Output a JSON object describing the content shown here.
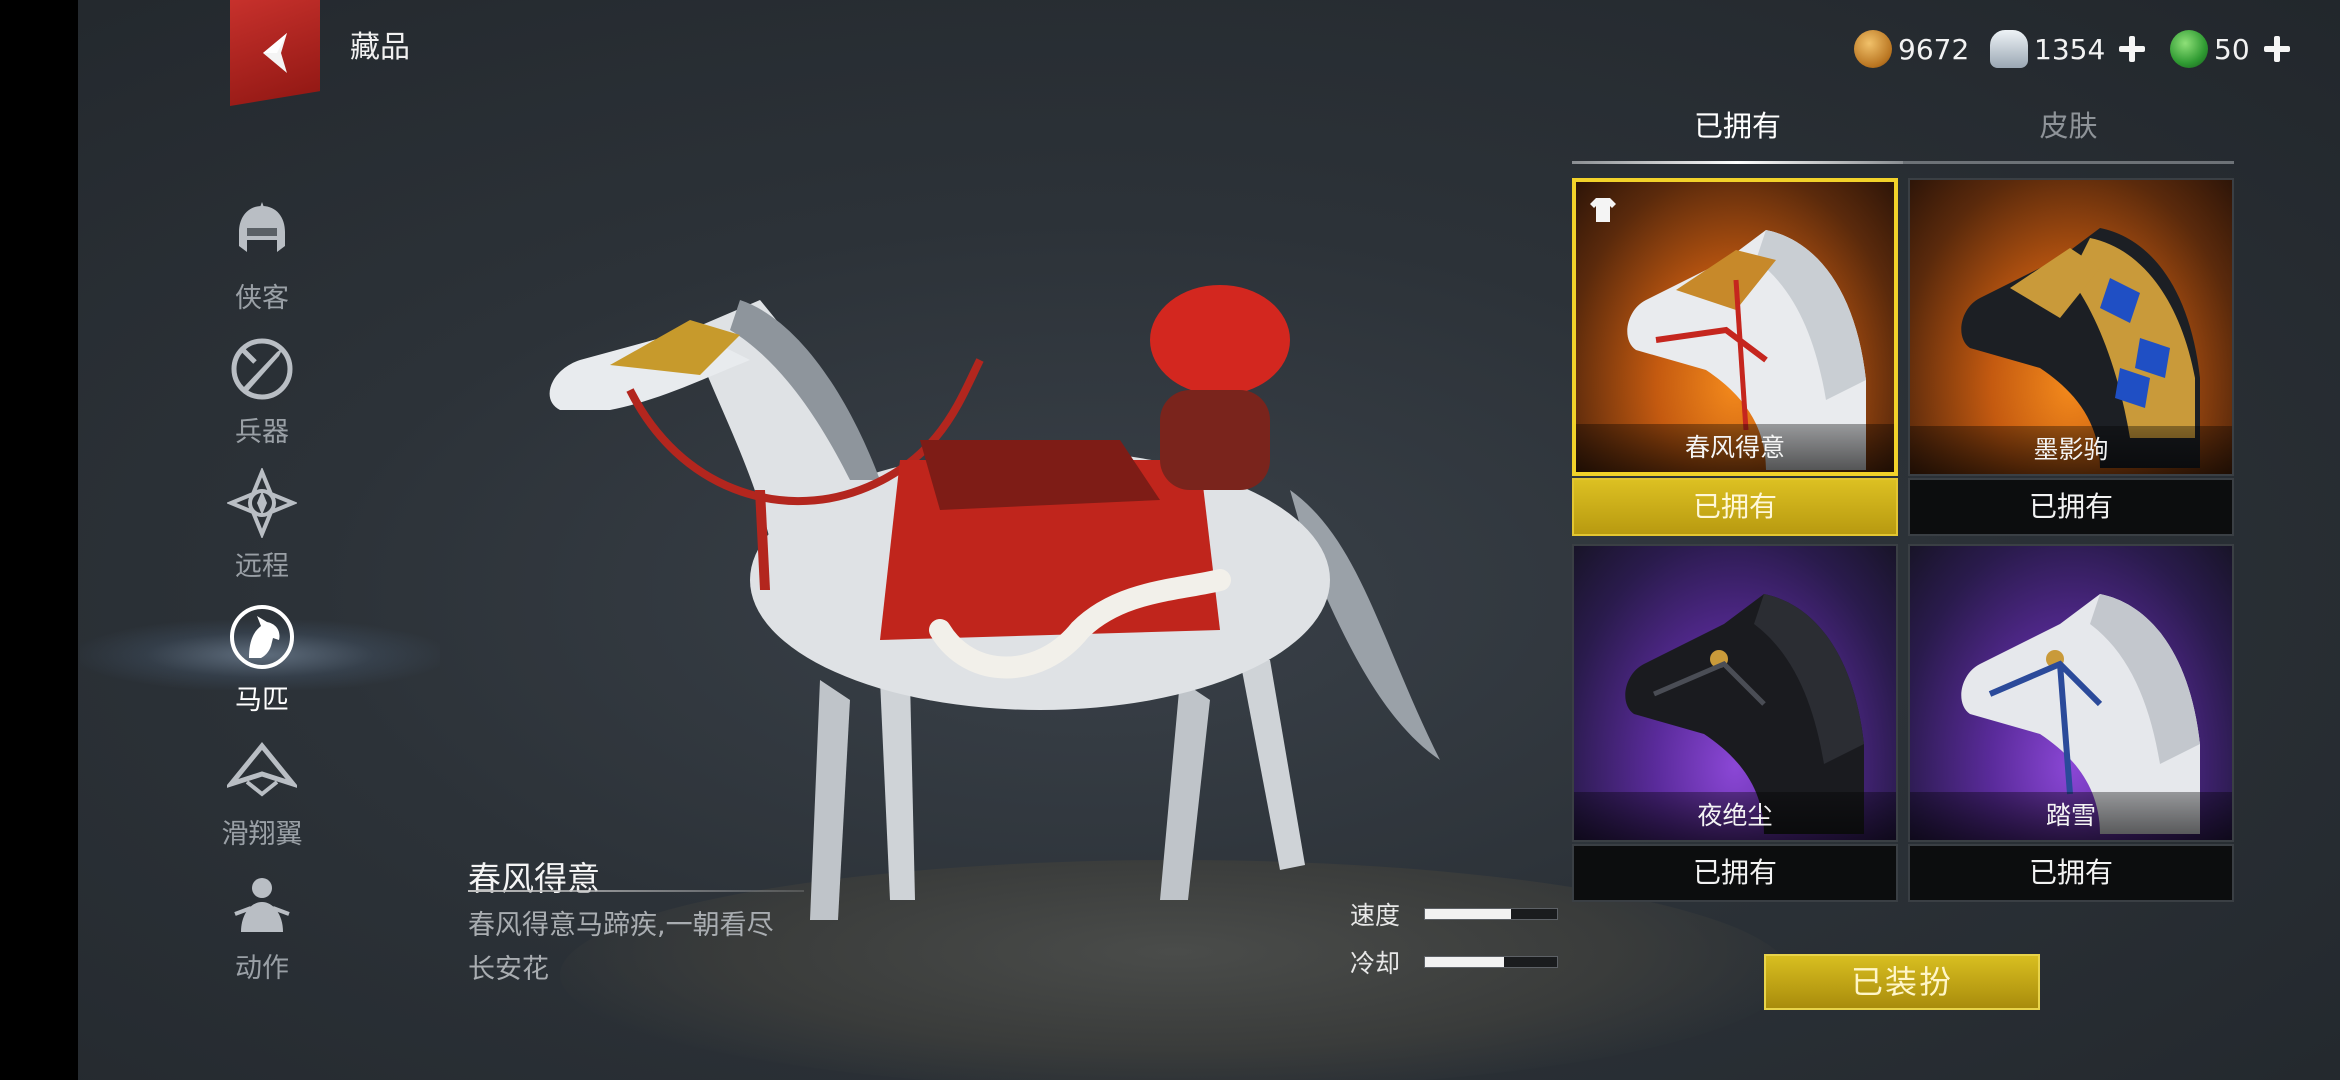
{
  "header": {
    "title": "藏品",
    "back_icon": "back-arrow-icon"
  },
  "currencies": [
    {
      "name": "copper-coin",
      "value": "9672",
      "icon": "coin-icon",
      "color": "#c98a2e",
      "has_add": false
    },
    {
      "name": "silver-ingot",
      "value": "1354",
      "icon": "silver-ingot-icon",
      "color": "#c9d3dc",
      "has_add": true
    },
    {
      "name": "jade",
      "value": "50",
      "icon": "jade-icon",
      "color": "#3aa23c",
      "has_add": true
    }
  ],
  "sidebar": {
    "items": [
      {
        "label": "侠客",
        "icon": "helmet-icon",
        "active": false
      },
      {
        "label": "兵器",
        "icon": "weapon-icon",
        "active": false
      },
      {
        "label": "远程",
        "icon": "ranged-icon",
        "active": false
      },
      {
        "label": "马匹",
        "icon": "horse-icon",
        "active": true
      },
      {
        "label": "滑翔翼",
        "icon": "glider-icon",
        "active": false
      },
      {
        "label": "动作",
        "icon": "emote-icon",
        "active": false
      }
    ]
  },
  "preview": {
    "item_name": "春风得意",
    "description": "春风得意马蹄疾,一朝看尽长安花",
    "stats": [
      {
        "label": "速度",
        "value": 0.65
      },
      {
        "label": "冷却",
        "value": 0.6
      }
    ]
  },
  "tabs": [
    {
      "label": "已拥有",
      "active": true
    },
    {
      "label": "皮肤",
      "active": false
    }
  ],
  "cards": [
    {
      "name": "春风得意",
      "status": "已拥有",
      "bg": "orange",
      "horse": "white-gold",
      "selected": true,
      "equipped": true
    },
    {
      "name": "墨影驹",
      "status": "已拥有",
      "bg": "orange",
      "horse": "black-blue-armor",
      "selected": false,
      "equipped": false
    },
    {
      "name": "夜绝尘",
      "status": "已拥有",
      "bg": "purple",
      "horse": "black",
      "selected": false,
      "equipped": false
    },
    {
      "name": "踏雪",
      "status": "已拥有",
      "bg": "purple",
      "horse": "white-blue",
      "selected": false,
      "equipped": false
    }
  ],
  "equip_button": {
    "label": "已装扮"
  },
  "colors": {
    "accent_gold": "#d8be20",
    "back_red": "#c7312c"
  }
}
